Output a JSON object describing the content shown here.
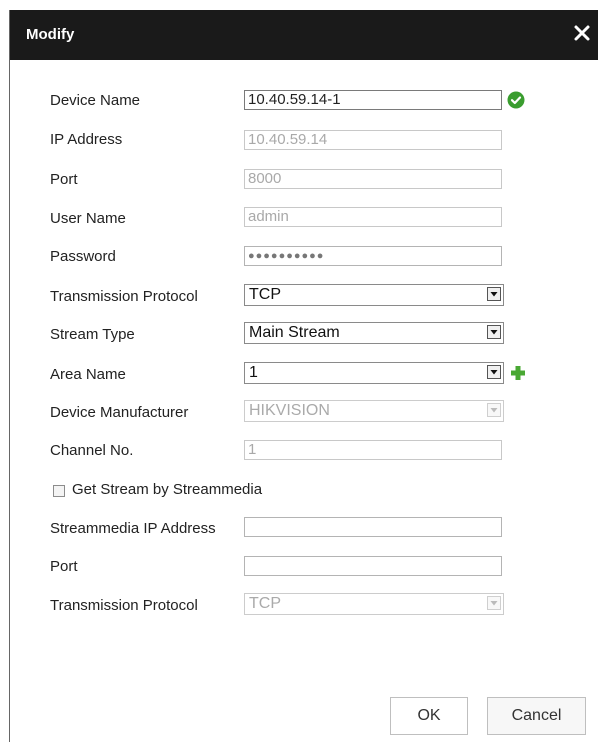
{
  "dialog": {
    "title": "Modify"
  },
  "form": {
    "device_name": {
      "label": "Device Name",
      "value": "10.40.59.14-1"
    },
    "ip_address": {
      "label": "IP Address",
      "value": "10.40.59.14"
    },
    "port": {
      "label": "Port",
      "value": "8000"
    },
    "user_name": {
      "label": "User Name",
      "value": "admin"
    },
    "password": {
      "label": "Password",
      "value": "●●●●●●●●●●"
    },
    "transmission_protocol": {
      "label": "Transmission Protocol",
      "value": "TCP"
    },
    "stream_type": {
      "label": "Stream Type",
      "value": "Main Stream"
    },
    "area_name": {
      "label": "Area Name",
      "value": "1"
    },
    "device_manufacturer": {
      "label": "Device Manufacturer",
      "value": "HIKVISION"
    },
    "channel_no": {
      "label": "Channel No.",
      "value": "1"
    },
    "get_stream_checkbox": {
      "label": "Get Stream by Streammedia",
      "checked": false
    },
    "streammedia_ip": {
      "label": "Streammedia IP Address",
      "value": ""
    },
    "streammedia_port": {
      "label": "Port",
      "value": ""
    },
    "streammedia_protocol": {
      "label": "Transmission Protocol",
      "value": "TCP"
    }
  },
  "buttons": {
    "ok": "OK",
    "cancel": "Cancel"
  },
  "colors": {
    "titlebar": "#1a1a1a",
    "valid": "#3a9d2f",
    "add": "#49a833"
  },
  "icons": {
    "close": "close-icon",
    "valid": "check-circle-icon",
    "add": "plus-icon",
    "dropdown": "dropdown-arrow-icon"
  }
}
